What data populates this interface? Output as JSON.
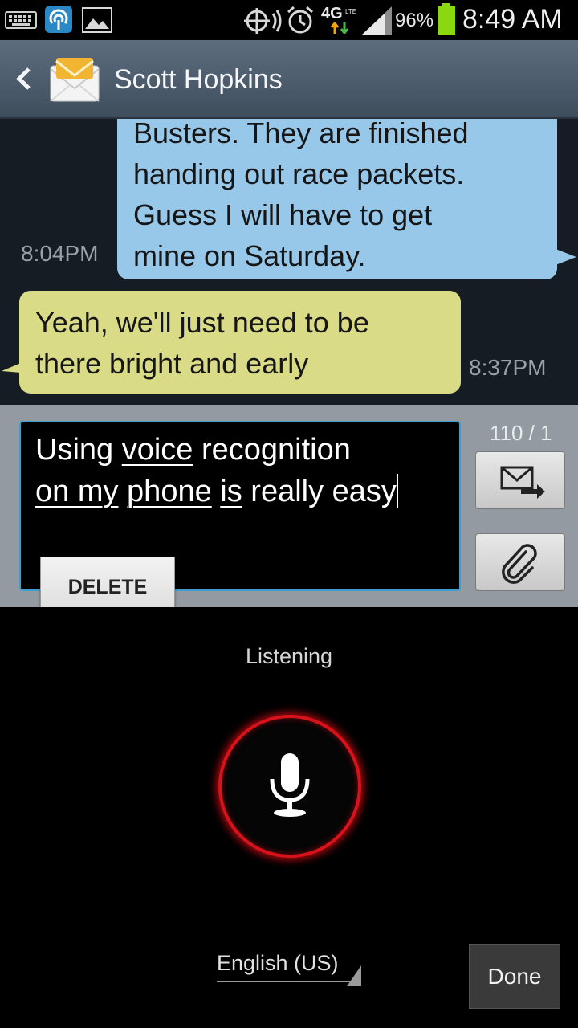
{
  "status_bar": {
    "battery": "96%",
    "time": "8:49 AM",
    "network": "4G",
    "network_sub": "LTE",
    "icons": [
      "keyboard-icon",
      "wifi-hotspot-icon",
      "gallery-icon",
      "location-icon",
      "alarm-icon",
      "signal-icon",
      "battery-icon"
    ]
  },
  "header": {
    "contact_name": "Scott Hopkins",
    "back_icon": "chevron-left-icon",
    "avatar_icon": "envelope-icon"
  },
  "messages": [
    {
      "direction": "outgoing",
      "lines": [
        "Busters. They are finished",
        "handing out race packets.",
        "Guess I will have to get",
        "mine on Saturday."
      ],
      "time": "8:04PM",
      "color": "#97c8ea"
    },
    {
      "direction": "incoming",
      "lines": [
        "Yeah, we'll just need to be",
        "there bright and early"
      ],
      "time": "8:37PM",
      "color": "#dadb86"
    }
  ],
  "compose": {
    "text_parts": [
      {
        "text": "Using ",
        "underline": false
      },
      {
        "text": "voice",
        "underline": true
      },
      {
        "text": " recognition ",
        "underline": false
      },
      {
        "text": "on my",
        "underline": true
      },
      {
        "text": " ",
        "underline": false
      },
      {
        "text": "phone",
        "underline": true
      },
      {
        "text": " ",
        "underline": false
      },
      {
        "text": "is",
        "underline": true
      },
      {
        "text": " really easy",
        "underline": false
      }
    ],
    "counter": "110 / 1",
    "send_icon": "send-message-icon",
    "attach_icon": "paperclip-icon",
    "delete_label": "DELETE",
    "accent": "#3c9fd0"
  },
  "voice_input": {
    "status": "Listening",
    "mic_icon": "microphone-icon",
    "ring_color": "#d8121b",
    "language": "English (US)",
    "done_label": "Done"
  }
}
